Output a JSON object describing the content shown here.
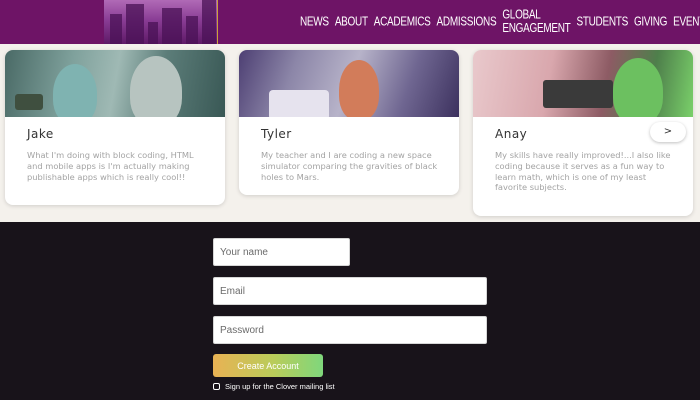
{
  "nav": {
    "items": [
      "NEWS",
      "ABOUT",
      "ACADEMICS",
      "ADMISSIONS",
      "GLOBAL ENGAGEMENT",
      "STUDENTS",
      "GIVING",
      "EVENTS"
    ]
  },
  "cards": [
    {
      "name": "Jake",
      "text": "What I'm doing with block coding, HTML and mobile apps is I'm actually making publishable apps which is really cool!!"
    },
    {
      "name": "Tyler",
      "text": "My teacher and I are coding a new space simulator comparing the gravities of black holes to Mars."
    },
    {
      "name": "Anay",
      "text": "My skills have really improved!...I also like coding because it serves as a fun way to learn math, which is one of my least favorite subjects."
    }
  ],
  "carousel": {
    "next_label": ">"
  },
  "form": {
    "name_placeholder": "Your name",
    "email_placeholder": "Email",
    "password_placeholder": "Password",
    "submit_label": "Create Account",
    "mailing_label": "Sign up for the Clover mailing list",
    "mailing_checked": false
  },
  "colors": {
    "header_bg": "#6e1466",
    "footer_bg": "#18131a",
    "button_gradient_start": "#e9b254",
    "button_gradient_end": "#7fd77c"
  }
}
